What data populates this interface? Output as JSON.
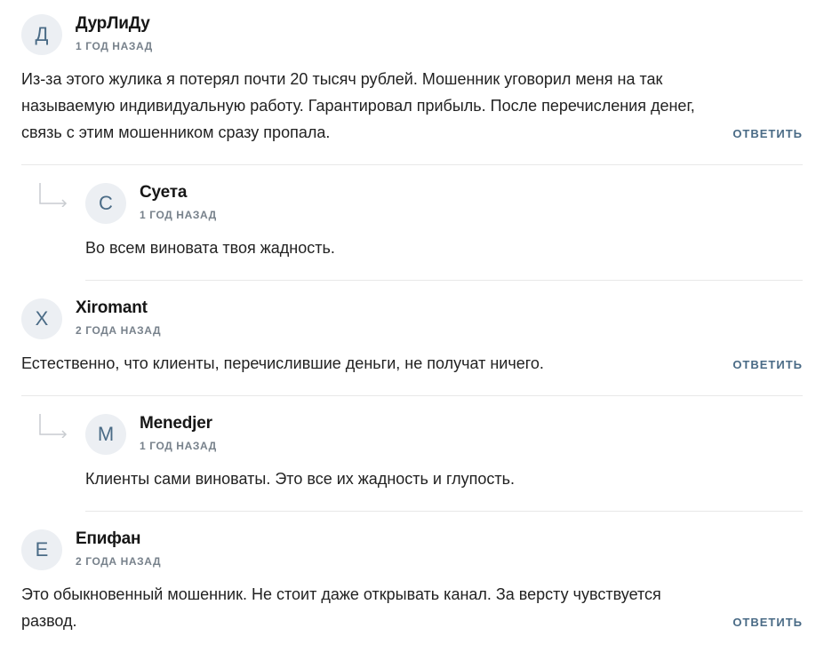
{
  "comments": [
    {
      "avatar_letter": "Д",
      "author": "ДурЛиДу",
      "date": "1 ГОД НАЗАД",
      "text_lines": [
        "Из-за этого жулика я потерял почти 20 тысяч рублей. Мошенник уговорил меня на так",
        "называемую индивидуальную работу. Гарантировал прибыль. После перечисления денег,",
        "связь с этим мошенником сразу пропала."
      ],
      "reply_label": "ОТВЕТИТЬ"
    },
    {
      "avatar_letter": "С",
      "author": "Суета",
      "date": "1 ГОД НАЗАД",
      "text_lines": [
        "Во всем виновата твоя жадность."
      ]
    },
    {
      "avatar_letter": "X",
      "author": "Xiromant",
      "date": "2 ГОДА НАЗАД",
      "text_lines": [
        "Естественно, что клиенты, перечислившие деньги, не получат ничего."
      ],
      "reply_label": "ОТВЕТИТЬ"
    },
    {
      "avatar_letter": "M",
      "author": "Menedjer",
      "date": "1 ГОД НАЗАД",
      "text_lines": [
        "Клиенты сами виноваты. Это все их жадность и глупость."
      ]
    },
    {
      "avatar_letter": "Е",
      "author": "Епифан",
      "date": "2 ГОДА НАЗАД",
      "text_lines": [
        "Это обыкновенный мошенник. Не стоит даже открывать канал. За версту чувствуется",
        "развод."
      ],
      "reply_label": "ОТВЕТИТЬ"
    }
  ]
}
